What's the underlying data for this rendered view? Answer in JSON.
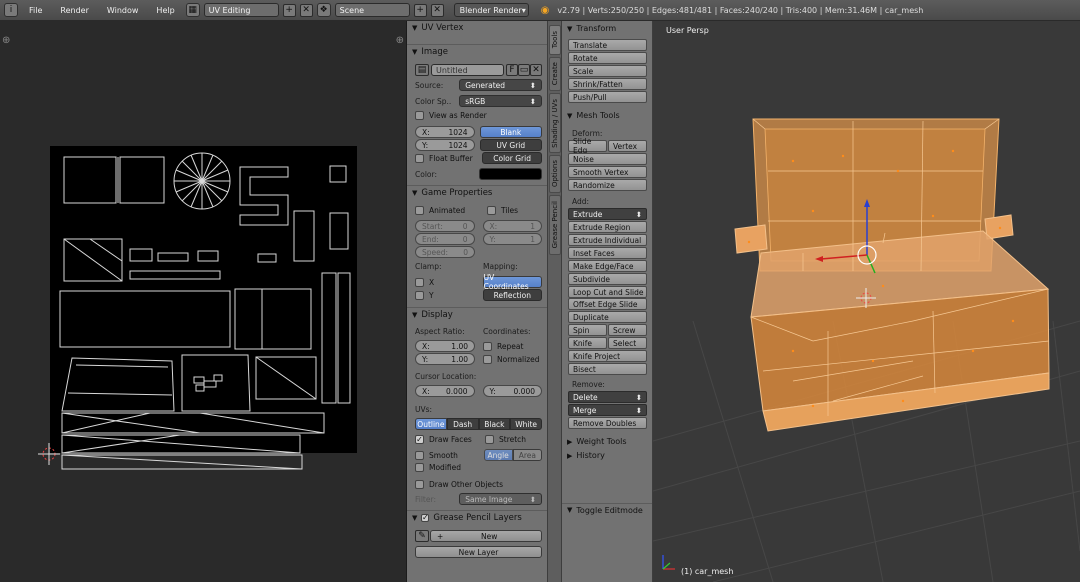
{
  "topbar": {
    "info_icon": "info-icon",
    "menus": [
      "File",
      "Render",
      "Window",
      "Help"
    ],
    "screen_layout": "UV Editing",
    "scene": "Scene",
    "render_engine": "Blender Render",
    "stats": "v2.79 | Verts:250/250 | Edges:481/481 | Faces:240/240 | Tris:400 | Mem:31.46M | car_mesh"
  },
  "properties": {
    "uv_vertex_header": "UV Vertex",
    "image_header": "Image",
    "image_name": "Untitled",
    "fake_user_label": "F",
    "source_label": "Source:",
    "source_value": "Generated",
    "color_space_label": "Color Sp..",
    "color_space_value": "sRGB",
    "view_as_render": "View as Render",
    "size_x_label": "X:",
    "size_x_value": "1024",
    "size_y_label": "Y:",
    "size_y_value": "1024",
    "generated_types": [
      "Blank",
      "UV Grid",
      "Color Grid"
    ],
    "generated_selected": "Blank",
    "float_buffer": "Float Buffer",
    "color_label": "Color:",
    "game_props_header": "Game Properties",
    "animated": "Animated",
    "tiles": "Tiles",
    "start_label": "Start:",
    "start_value": "0",
    "end_label": "End:",
    "end_value": "0",
    "speed_label": "Speed:",
    "speed_value": "0",
    "tiles_x_label": "X:",
    "tiles_x_value": "1",
    "tiles_y_label": "Y:",
    "tiles_y_value": "1",
    "clamp_label": "Clamp:",
    "clamp_x": "X",
    "clamp_y": "Y",
    "mapping_label": "Mapping:",
    "mapping_options": [
      "UV Coordinates",
      "Reflection"
    ],
    "display_header": "Display",
    "aspect_label": "Aspect Ratio:",
    "aspect_x_label": "X:",
    "aspect_x_value": "1.00",
    "aspect_y_label": "Y:",
    "aspect_y_value": "1.00",
    "coordinates_label": "Coordinates:",
    "repeat": "Repeat",
    "normalized": "Normalized",
    "cursor_location_label": "Cursor Location:",
    "cursor_x_label": "X:",
    "cursor_x_value": "0.000",
    "cursor_y_label": "Y:",
    "cursor_y_value": "0.000",
    "uvs_label": "UVs:",
    "uv_draw_types": [
      "Outline",
      "Dash",
      "Black",
      "White"
    ],
    "draw_faces": "Draw Faces",
    "stretch": "Stretch",
    "smooth": "Smooth",
    "stretch_types": [
      "Angle",
      "Area"
    ],
    "modified": "Modified",
    "draw_other_objects": "Draw Other Objects",
    "filter_label": "Filter:",
    "filter_value": "Same Image",
    "grease_header": "Grease Pencil Layers",
    "new_label": "New",
    "new_layer_label": "New Layer"
  },
  "tool_tabs": [
    "Tools",
    "Create",
    "Shading / UVs",
    "Options",
    "Grease Pencil"
  ],
  "tools": {
    "transform_header": "Transform",
    "transform": [
      "Translate",
      "Rotate",
      "Scale",
      "Shrink/Fatten",
      "Push/Pull"
    ],
    "mesh_tools_header": "Mesh Tools",
    "deform_label": "Deform:",
    "slide_edge": "Slide Edg",
    "vertex": "Vertex",
    "noise": "Noise",
    "smooth_vertex": "Smooth Vertex",
    "randomize": "Randomize",
    "add_label": "Add:",
    "extrude": "Extrude",
    "add_tools": [
      "Extrude Region",
      "Extrude Individual",
      "Inset Faces",
      "Make Edge/Face",
      "Subdivide",
      "Loop Cut and Slide",
      "Offset Edge Slide",
      "Duplicate"
    ],
    "spin": "Spin",
    "screw": "Screw",
    "knife": "Knife",
    "select": "Select",
    "knife_project": "Knife Project",
    "bisect": "Bisect",
    "remove_label": "Remove:",
    "delete": "Delete",
    "merge": "Merge",
    "remove_doubles": "Remove Doubles",
    "weight_tools_header": "Weight Tools",
    "history_header": "History",
    "toggle_editmode": "Toggle Editmode"
  },
  "viewport": {
    "view_label": "User Persp",
    "object_label": "(1) car_mesh"
  },
  "colors": {
    "accent_blue": "#5680c9",
    "mesh_orange": "#f0a040",
    "header_bg": "#4a4a4a",
    "panel_bg": "#727272",
    "viewport_bg": "#393939"
  }
}
